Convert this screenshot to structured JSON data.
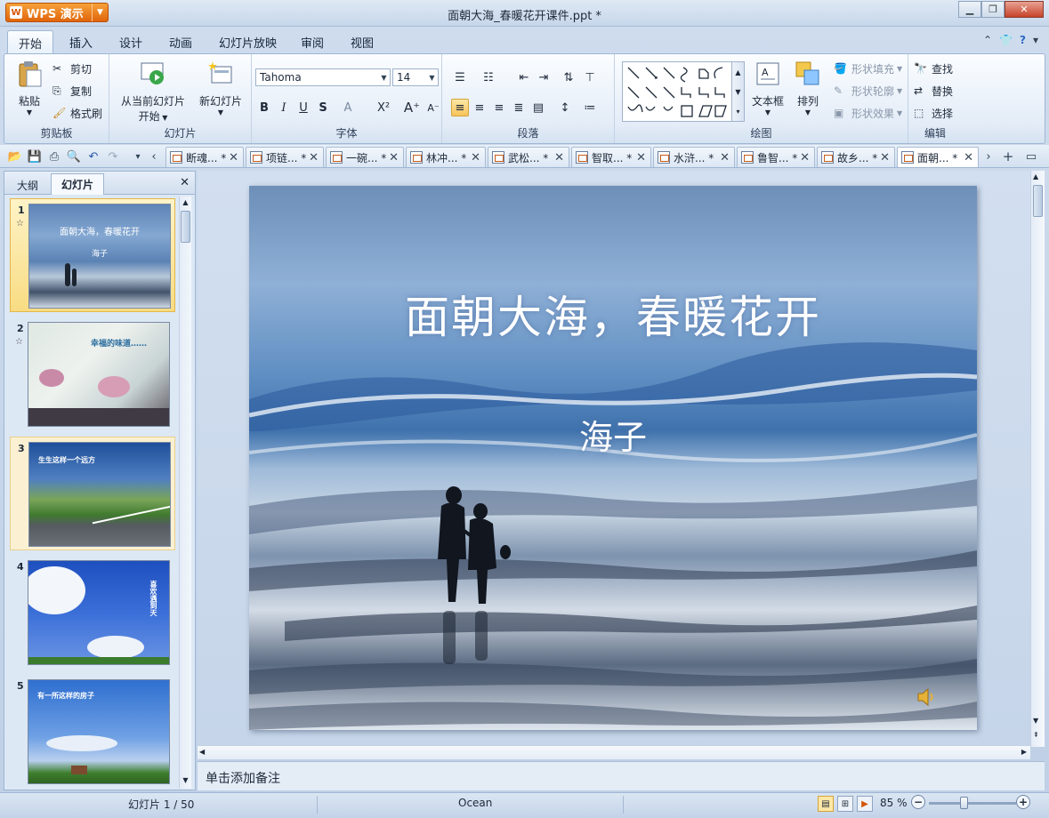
{
  "app": {
    "brand": "WPS 演示",
    "doc_title": "面朝大海_春暖花开课件.ppt *"
  },
  "menu": {
    "tabs": [
      "开始",
      "插入",
      "设计",
      "动画",
      "幻灯片放映",
      "审阅",
      "视图"
    ]
  },
  "ribbon": {
    "clipboard": {
      "paste": "粘贴",
      "cut": "剪切",
      "copy": "复制",
      "format_painter": "格式刷",
      "label": "剪贴板"
    },
    "slides": {
      "from_current": "从当前幻灯片",
      "start": "开始",
      "new_slide": "新幻灯片",
      "label": "幻灯片"
    },
    "font": {
      "family": "Tahoma",
      "size": "14",
      "label": "字体"
    },
    "paragraph": {
      "label": "段落"
    },
    "drawing": {
      "textbox": "文本框",
      "arrange": "排列",
      "shape_fill": "形状填充",
      "shape_outline": "形状轮廓",
      "shape_effect": "形状效果",
      "label": "绘图"
    },
    "editing": {
      "find": "查找",
      "replace": "替换",
      "select": "选择",
      "label": "编辑"
    }
  },
  "doc_tabs": [
    {
      "label": "断魂... *"
    },
    {
      "label": "项链... *"
    },
    {
      "label": "一碗... *"
    },
    {
      "label": "林冲... *"
    },
    {
      "label": "武松... *"
    },
    {
      "label": "智取... *"
    },
    {
      "label": "水浒... *"
    },
    {
      "label": "鲁智... *"
    },
    {
      "label": "故乡... *"
    },
    {
      "label": "面朝... *"
    }
  ],
  "left_pane": {
    "tabs": [
      "大纲",
      "幻灯片"
    ],
    "thumbs": [
      {
        "num": "1",
        "title": "面朝大海，春暖花开",
        "sub": "海子"
      },
      {
        "num": "2",
        "title": "幸福的味道……"
      },
      {
        "num": "3",
        "title": "生生这样一个远方"
      },
      {
        "num": "4",
        "title": "喜欢遇到天"
      },
      {
        "num": "5",
        "title": "有一所这样的房子"
      }
    ]
  },
  "slide": {
    "title": "面朝大海，春暖花开",
    "subtitle": "海子"
  },
  "notes": {
    "placeholder": "单击添加备注"
  },
  "status": {
    "slide_count": "幻灯片 1 / 50",
    "theme": "Ocean",
    "zoom": "85 %"
  },
  "icons": {
    "close": "close-icon",
    "speaker": "speaker-icon"
  }
}
